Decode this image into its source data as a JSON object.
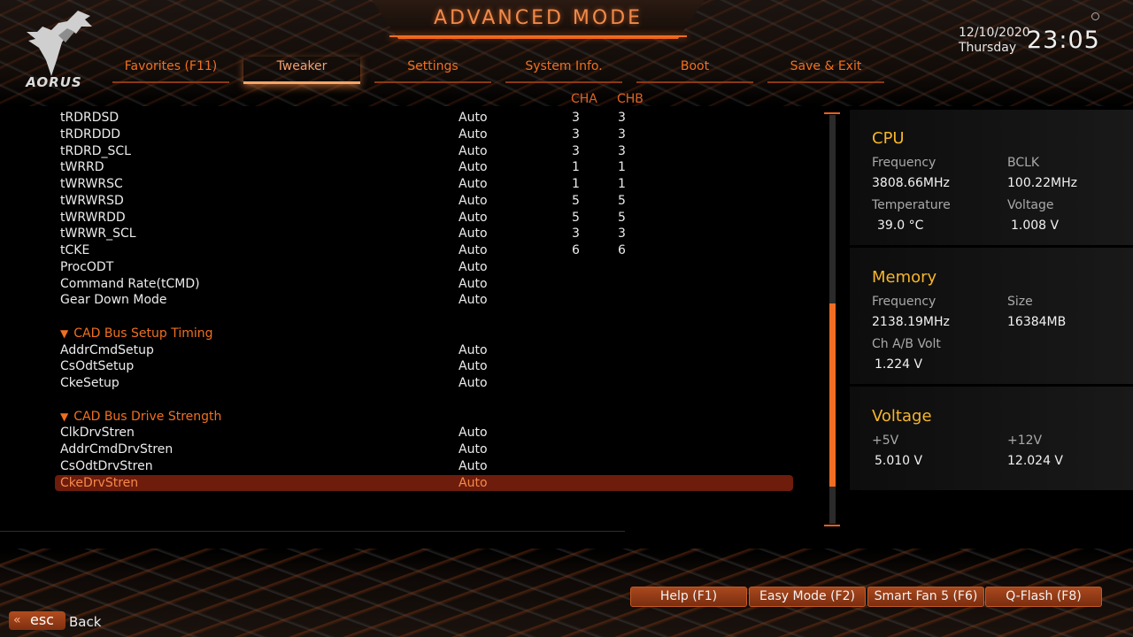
{
  "header": {
    "title": "ADVANCED MODE",
    "logo_text": "AORUS",
    "date": "12/10/2020",
    "weekday": "Thursday",
    "time": "23:05"
  },
  "tabs": [
    {
      "label": "Favorites (F11)",
      "active": false
    },
    {
      "label": "Tweaker",
      "active": true
    },
    {
      "label": "Settings",
      "active": false
    },
    {
      "label": "System Info.",
      "active": false
    },
    {
      "label": "Boot",
      "active": false
    },
    {
      "label": "Save & Exit",
      "active": false
    }
  ],
  "columns": {
    "cha": "CHA",
    "chb": "CHB"
  },
  "settings": [
    {
      "name": "tRDRDSD",
      "value": "Auto",
      "cha": "3",
      "chb": "3"
    },
    {
      "name": "tRDRDDD",
      "value": "Auto",
      "cha": "3",
      "chb": "3"
    },
    {
      "name": "tRDRD_SCL",
      "value": "Auto",
      "cha": "3",
      "chb": "3"
    },
    {
      "name": "tWRRD",
      "value": "Auto",
      "cha": "1",
      "chb": "1"
    },
    {
      "name": "tWRWRSC",
      "value": "Auto",
      "cha": "1",
      "chb": "1"
    },
    {
      "name": "tWRWRSD",
      "value": "Auto",
      "cha": "5",
      "chb": "5"
    },
    {
      "name": "tWRWRDD",
      "value": "Auto",
      "cha": "5",
      "chb": "5"
    },
    {
      "name": "tWRWR_SCL",
      "value": "Auto",
      "cha": "3",
      "chb": "3"
    },
    {
      "name": "tCKE",
      "value": "Auto",
      "cha": "6",
      "chb": "6"
    },
    {
      "name": "ProcODT",
      "value": "Auto",
      "cha": "",
      "chb": ""
    },
    {
      "name": "Command Rate(tCMD)",
      "value": "Auto",
      "cha": "",
      "chb": ""
    },
    {
      "name": "Gear Down Mode",
      "value": "Auto",
      "cha": "",
      "chb": ""
    },
    {
      "name": "",
      "value": "",
      "cha": "",
      "chb": "",
      "spacer": true
    },
    {
      "name": "CAD Bus Setup Timing",
      "value": "",
      "cha": "",
      "chb": "",
      "section": true
    },
    {
      "name": "AddrCmdSetup",
      "value": "Auto",
      "cha": "",
      "chb": ""
    },
    {
      "name": "CsOdtSetup",
      "value": "Auto",
      "cha": "",
      "chb": ""
    },
    {
      "name": "CkeSetup",
      "value": "Auto",
      "cha": "",
      "chb": ""
    },
    {
      "name": "",
      "value": "",
      "cha": "",
      "chb": "",
      "spacer": true
    },
    {
      "name": "CAD Bus Drive Strength",
      "value": "",
      "cha": "",
      "chb": "",
      "section": true
    },
    {
      "name": "ClkDrvStren",
      "value": "Auto",
      "cha": "",
      "chb": ""
    },
    {
      "name": "AddrCmdDrvStren",
      "value": "Auto",
      "cha": "",
      "chb": ""
    },
    {
      "name": "CsOdtDrvStren",
      "value": "Auto",
      "cha": "",
      "chb": ""
    },
    {
      "name": "CkeDrvStren",
      "value": "Auto",
      "cha": "",
      "chb": "",
      "selected": true
    }
  ],
  "scroll": {
    "thumb_start_fraction": 0.46,
    "thumb_size_fraction": 0.45
  },
  "info": {
    "cpu": {
      "title": "CPU",
      "frequency_label": "Frequency",
      "frequency": "3808.66MHz",
      "bclk_label": "BCLK",
      "bclk": "100.22MHz",
      "temperature_label": "Temperature",
      "temperature": "39.0 °C",
      "voltage_label": "Voltage",
      "voltage": "1.008 V"
    },
    "memory": {
      "title": "Memory",
      "frequency_label": "Frequency",
      "frequency": "2138.19MHz",
      "size_label": "Size",
      "size": "16384MB",
      "volt_label": "Ch A/B Volt",
      "volt": "1.224 V"
    },
    "voltage": {
      "title": "Voltage",
      "v5_label": "+5V",
      "v5": "5.010 V",
      "v12_label": "+12V",
      "v12": "12.024 V"
    }
  },
  "buttons": {
    "help": "Help (F1)",
    "easy_mode": "Easy Mode (F2)",
    "smart_fan": "Smart Fan 5 (F6)",
    "qflash": "Q-Flash (F8)",
    "esc": "esc",
    "back": "Back"
  },
  "colors": {
    "accent": "#f0701f",
    "title_yellow": "#f5b62a",
    "selected_row": "#6e1c0c"
  }
}
